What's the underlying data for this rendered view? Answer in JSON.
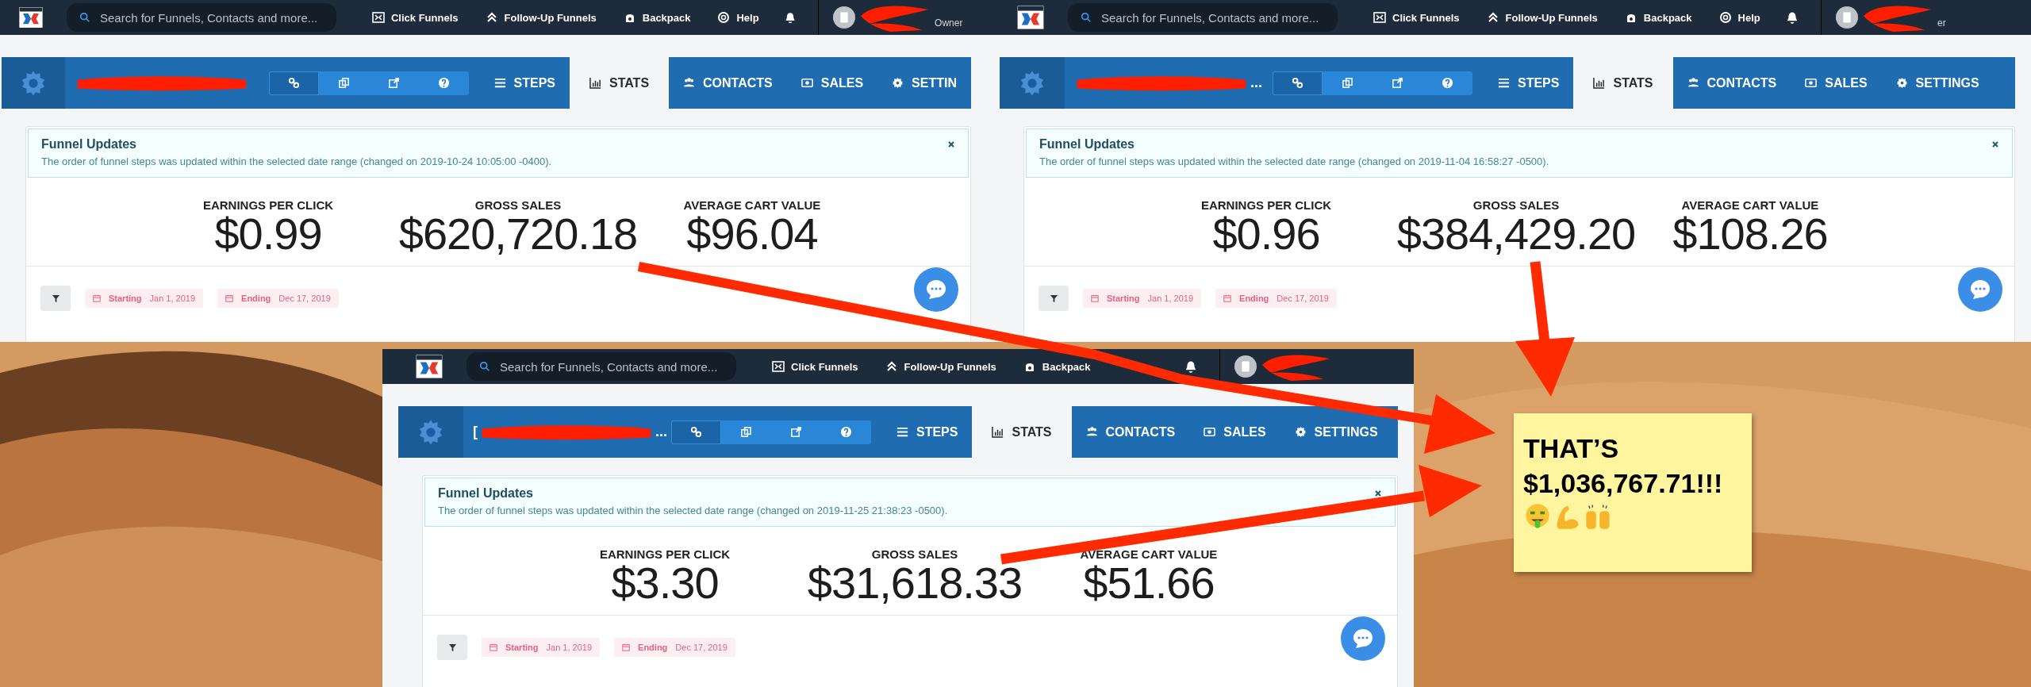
{
  "windows": [
    {
      "search_placeholder": "Search for Funnels, Contacts and more...",
      "nav": [
        {
          "kind": "funnels",
          "label": "Click Funnels"
        },
        {
          "kind": "followup",
          "label": "Follow-Up Funnels"
        },
        {
          "kind": "backpack",
          "label": "Backpack"
        },
        {
          "kind": "help",
          "label": "Help"
        }
      ],
      "role": "Owner",
      "tool_buttons": [
        {
          "kind": "link",
          "selected": true
        },
        {
          "kind": "copy",
          "selected": false
        },
        {
          "kind": "external",
          "selected": false
        },
        {
          "kind": "help",
          "selected": false
        }
      ],
      "tabs": [
        {
          "kind": "steps",
          "label": "STEPS",
          "selected": false
        },
        {
          "kind": "stats",
          "label": "STATS",
          "selected": true
        },
        {
          "kind": "contacts",
          "label": "CONTACTS",
          "selected": false
        },
        {
          "kind": "sales",
          "label": "SALES",
          "selected": false
        },
        {
          "kind": "settings",
          "label": "SETTIN",
          "selected": false
        }
      ],
      "alert": {
        "title": "Funnel Updates",
        "text": "The order of funnel steps was updated within the selected date range (changed on 2019-10-24 10:05:00 -0400)."
      },
      "stats": [
        {
          "label": "EARNINGS PER CLICK",
          "value": "$0.99"
        },
        {
          "label": "GROSS SALES",
          "value": "$620,720.18"
        },
        {
          "label": "AVERAGE CART VALUE",
          "value": "$96.04"
        }
      ],
      "filters": [
        {
          "label": "Starting",
          "value": "Jan 1, 2019"
        },
        {
          "label": "Ending",
          "value": "Dec 17, 2019"
        }
      ]
    },
    {
      "search_placeholder": "Search for Funnels, Contacts and more...",
      "nav": [
        {
          "kind": "funnels",
          "label": "Click Funnels"
        },
        {
          "kind": "followup",
          "label": "Follow-Up Funnels"
        },
        {
          "kind": "backpack",
          "label": "Backpack"
        },
        {
          "kind": "help",
          "label": "Help"
        }
      ],
      "role": "er",
      "funnel_name_tail": "...",
      "tool_buttons": [
        {
          "kind": "link",
          "selected": true
        },
        {
          "kind": "copy",
          "selected": false
        },
        {
          "kind": "external",
          "selected": false
        },
        {
          "kind": "help",
          "selected": false
        }
      ],
      "tabs": [
        {
          "kind": "steps",
          "label": "STEPS",
          "selected": false
        },
        {
          "kind": "stats",
          "label": "STATS",
          "selected": true
        },
        {
          "kind": "contacts",
          "label": "CONTACTS",
          "selected": false
        },
        {
          "kind": "sales",
          "label": "SALES",
          "selected": false
        },
        {
          "kind": "settings",
          "label": "SETTINGS",
          "selected": false
        }
      ],
      "alert": {
        "title": "Funnel Updates",
        "text": "The order of funnel steps was updated within the selected date range (changed on 2019-11-04 16:58:27 -0500)."
      },
      "stats": [
        {
          "label": "EARNINGS PER CLICK",
          "value": "$0.96"
        },
        {
          "label": "GROSS SALES",
          "value": "$384,429.20"
        },
        {
          "label": "AVERAGE CART VALUE",
          "value": "$108.26"
        }
      ],
      "filters": [
        {
          "label": "Starting",
          "value": "Jan 1, 2019"
        },
        {
          "label": "Ending",
          "value": "Dec 17, 2019"
        }
      ]
    },
    {
      "search_placeholder": "Search for Funnels, Contacts and more...",
      "nav": [
        {
          "kind": "funnels",
          "label": "Click Funnels"
        },
        {
          "kind": "followup",
          "label": "Follow-Up Funnels"
        },
        {
          "kind": "backpack",
          "label": "Backpack"
        }
      ],
      "funnel_name_head": "[",
      "funnel_name_tail": "...",
      "tool_buttons": [
        {
          "kind": "link",
          "selected": true
        },
        {
          "kind": "copy",
          "selected": false
        },
        {
          "kind": "external",
          "selected": false
        },
        {
          "kind": "help",
          "selected": false
        }
      ],
      "tabs": [
        {
          "kind": "steps",
          "label": "STEPS",
          "selected": false
        },
        {
          "kind": "stats",
          "label": "STATS",
          "selected": true
        },
        {
          "kind": "contacts",
          "label": "CONTACTS",
          "selected": false
        },
        {
          "kind": "sales",
          "label": "SALES",
          "selected": false
        },
        {
          "kind": "settings",
          "label": "SETTINGS",
          "selected": false
        }
      ],
      "alert": {
        "title": "Funnel Updates",
        "text": "The order of funnel steps was updated within the selected date range (changed on 2019-11-25 21:38:23 -0500)."
      },
      "stats": [
        {
          "label": "EARNINGS PER CLICK",
          "value": "$3.30"
        },
        {
          "label": "GROSS SALES",
          "value": "$31,618.33"
        },
        {
          "label": "AVERAGE CART VALUE",
          "value": "$51.66"
        }
      ],
      "filters": [
        {
          "label": "Starting",
          "value": "Jan 1, 2019"
        },
        {
          "label": "Ending",
          "value": "Dec 17, 2019"
        }
      ]
    }
  ],
  "sticky_note": {
    "lines": [
      "THAT’S",
      "$1,036,767.71!!!"
    ]
  }
}
